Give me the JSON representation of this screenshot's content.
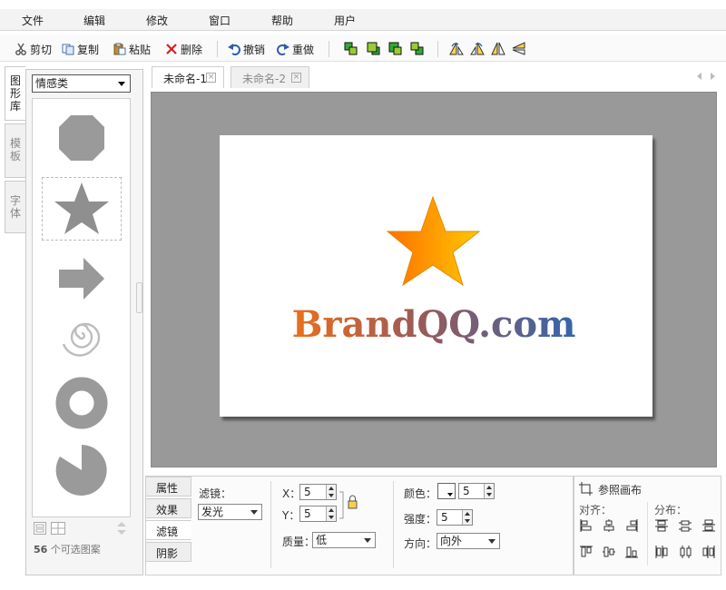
{
  "menu": [
    "文件",
    "编辑",
    "修改",
    "窗口",
    "帮助",
    "用户"
  ],
  "toolbar": {
    "cut": "剪切",
    "copy": "复制",
    "paste": "粘贴",
    "delete": "删除",
    "undo": "撤销",
    "redo": "重做"
  },
  "side_tabs": [
    "图形库",
    "模板",
    "字体"
  ],
  "shape_library": {
    "category": "情感类",
    "count": "56",
    "count_suffix": "个可选图案"
  },
  "doc_tabs": [
    "未命名-1",
    "未命名-2"
  ],
  "canvas": {
    "logo_text": "BrandQQ.com",
    "colors": {
      "workspace": "#999999",
      "star_start": "#ff7a00",
      "star_end": "#ffc400",
      "text_start": "#e87020",
      "text_end": "#3a64a8"
    }
  },
  "bottom_tabs": [
    "属性",
    "效果",
    "滤镜",
    "阴影"
  ],
  "filter": {
    "filter_label": "滤镜：",
    "filter_value": "发光",
    "x_label": "X：",
    "x_value": "5",
    "y_label": "Y：",
    "y_value": "5",
    "quality_label": "质量：",
    "quality_value": "低",
    "color_label": "颜色：",
    "color_value": "5",
    "strength_label": "强度：",
    "strength_value": "5",
    "direction_label": "方向：",
    "direction_value": "向外"
  },
  "align_panel": {
    "ref_canvas": "参照画布",
    "align_label": "对齐：",
    "distribute_label": "分布："
  }
}
